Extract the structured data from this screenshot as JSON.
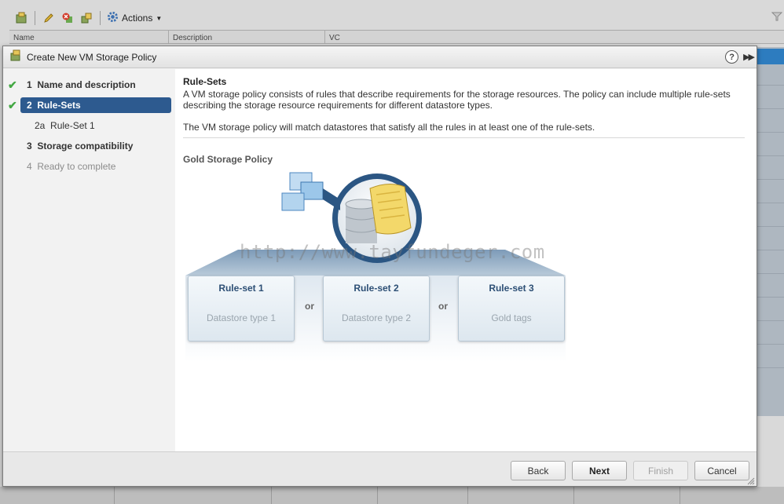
{
  "background": {
    "toolbar": {
      "actions_label": "Actions"
    },
    "grid_columns": [
      "Name",
      "Description",
      "VC"
    ]
  },
  "dialog": {
    "title": "Create New VM Storage Policy",
    "help_glyph": "?",
    "steps": [
      {
        "num": "1",
        "label": "Name and description",
        "state": "done"
      },
      {
        "num": "2",
        "label": "Rule-Sets",
        "state": "active"
      },
      {
        "num": "2a",
        "label": "Rule-Set 1",
        "state": "sub"
      },
      {
        "num": "3",
        "label": "Storage compatibility",
        "state": "done"
      },
      {
        "num": "4",
        "label": "Ready to complete",
        "state": "disabled"
      }
    ],
    "content": {
      "section_title": "Rule-Sets",
      "description": "A VM storage policy consists of rules that describe requirements for the storage resources. The policy can include multiple rule-sets describing the storage resource requirements for different datastore types.",
      "description2": "The VM storage policy will match datastores that satisfy all the rules in at least one of the rule-sets.",
      "policy_title": "Gold Storage Policy",
      "rulesets": [
        {
          "title": "Rule-set 1",
          "subtitle": "Datastore type 1"
        },
        {
          "title": "Rule-set 2",
          "subtitle": "Datastore type 2"
        },
        {
          "title": "Rule-set 3",
          "subtitle": "Gold tags"
        }
      ],
      "or_label": "or",
      "watermark": "http://www.tayfundeger.com"
    },
    "buttons": {
      "back": "Back",
      "next": "Next",
      "finish": "Finish",
      "cancel": "Cancel"
    }
  },
  "colors": {
    "active_step": "#2d5a8f",
    "check": "#43a843",
    "ruleset_title": "#2d4f75"
  }
}
